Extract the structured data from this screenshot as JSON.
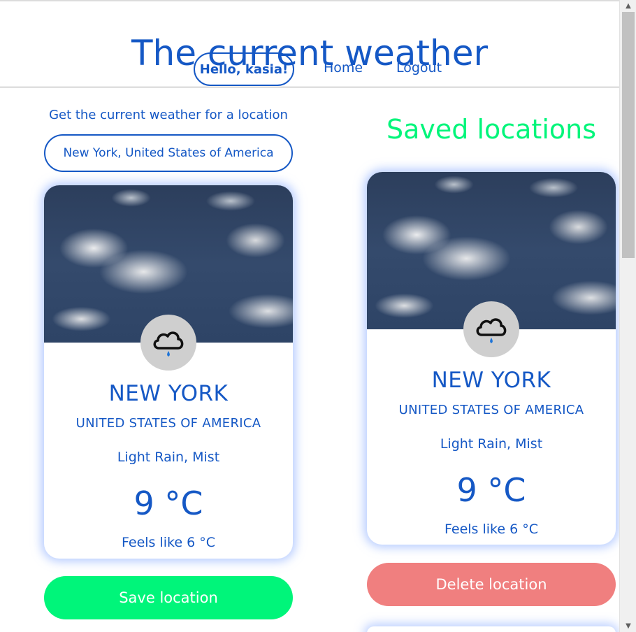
{
  "header": {
    "title": "The current weather",
    "greeting": "Hello, kasia!",
    "nav_home": "Home",
    "nav_logout": "Logout"
  },
  "search": {
    "label": "Get the current weather for a location",
    "value": "New York, United States of America"
  },
  "current_card": {
    "city": "NEW YORK",
    "country": "UNITED STATES OF AMERICA",
    "description": "Light Rain, Mist",
    "temperature": "9 °C",
    "feels_like": "Feels like 6 °C",
    "icon": "cloud-rain-icon"
  },
  "save_button": "Save location",
  "saved": {
    "title": "Saved locations",
    "cards": [
      {
        "city": "NEW YORK",
        "country": "UNITED STATES OF AMERICA",
        "description": "Light Rain, Mist",
        "temperature": "9 °C",
        "feels_like": "Feels like 6 °C",
        "icon": "cloud-rain-icon"
      }
    ],
    "delete_button": "Delete location"
  },
  "colors": {
    "primary_blue": "#1558c5",
    "accent_green": "#00f57a",
    "delete_red": "#f07f7f",
    "icon_bg": "#cfcfcf"
  }
}
